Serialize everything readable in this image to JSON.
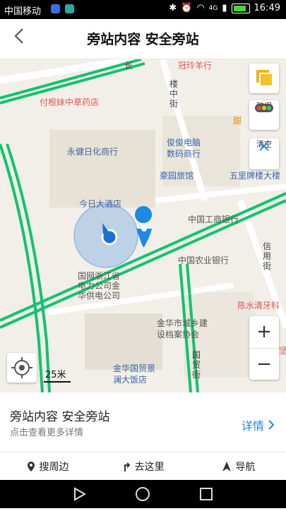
{
  "status_bar": {
    "carrier": "中国移动",
    "network": "4G",
    "time": "16:49"
  },
  "header": {
    "back_icon": "chevron-left-icon",
    "title": "旁站内容 安全旁站"
  },
  "map": {
    "road_color": "#13c26e",
    "labels": {
      "pharmacy": "付根妹中草药店",
      "hardware": "永健日化商行",
      "hotel": "今日大酒店",
      "grid": "国网浙江省\n电力公司金\n华供电公司",
      "guanling": "冠玲羊行",
      "street_louzhong": "楼中街",
      "computer": "俊俊电脑\n数码商行",
      "haoyuan": "豪园旅馆",
      "wulipai": "五里牌楼大楼",
      "icbc": "中国工商银行",
      "abc": "中国农业银行",
      "street_xincheng": "信用街",
      "dental": "陈水清牙科",
      "archive": "金华市城乡建\n设档案协会",
      "trade_hotel": "金华国贸景\n澜大饭店",
      "street_guomao": "国贸街",
      "tian": "甜",
      "partial_right": "坚",
      "road_top": "长"
    },
    "scale": "25米",
    "controls": {
      "layers_icon": "layers-icon",
      "traffic_label": "路况",
      "clear_label": "清空",
      "zoom_in": "+",
      "zoom_out": "−"
    }
  },
  "sheet": {
    "name": "旁站内容 安全旁站",
    "hint": "点击查看更多详情",
    "detail": "详情",
    "actions": {
      "nearby": "搜周边",
      "go_here": "去这里",
      "navigate": "导航"
    }
  }
}
